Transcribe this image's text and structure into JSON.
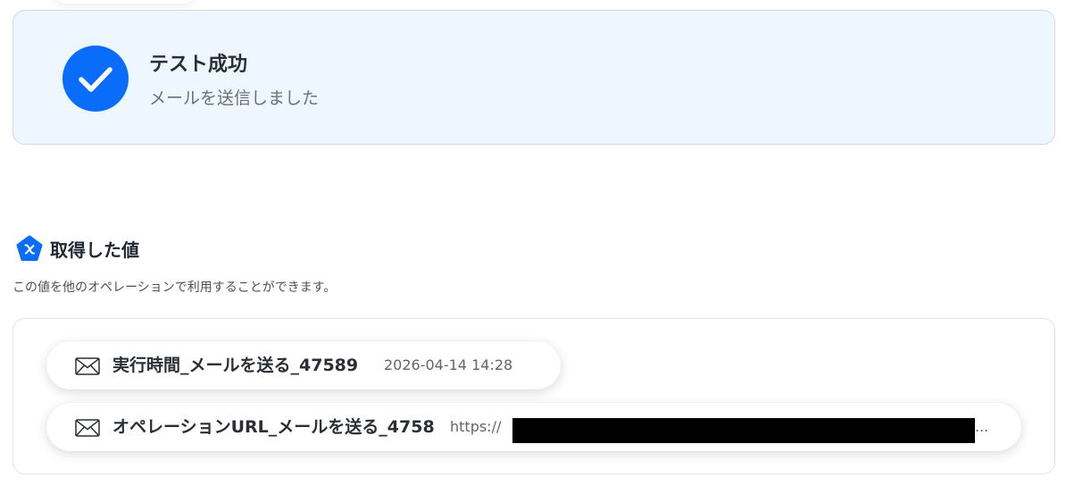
{
  "success": {
    "title": "テスト成功",
    "message": "メールを送信しました",
    "accent_color": "#0a6dfa",
    "icon": "check-icon"
  },
  "output_section": {
    "icon": "variable-x-icon",
    "title": "取得した値",
    "description": "この値を他のオペレーションで利用することができます。",
    "items": [
      {
        "icon": "mail-icon",
        "name": "実行時間_メールを送る_47589",
        "value": "2026-04-14 14:28"
      },
      {
        "icon": "mail-icon",
        "name": "オペレーションURL_メールを送る_4758",
        "value": "https://",
        "value_redacted": true,
        "value_suffix": "..."
      }
    ]
  }
}
